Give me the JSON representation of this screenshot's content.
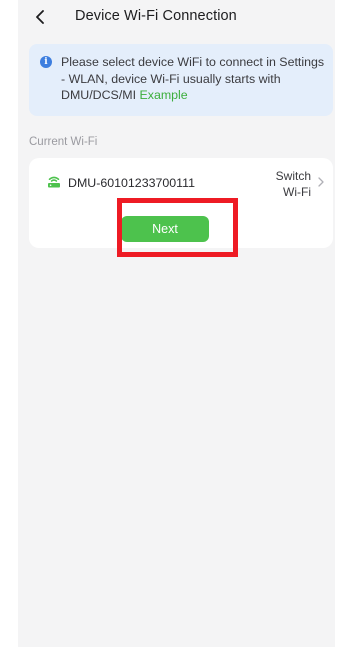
{
  "header": {
    "title": "Device Wi-Fi Connection",
    "back_icon": "chevron-left-icon"
  },
  "notice": {
    "icon": "info-icon",
    "icon_glyph": "i",
    "text": "Please select device WiFi to connect in Settings - WLAN, device Wi-Fi usually starts with DMU/DCS/MI",
    "link": "Example"
  },
  "current_wifi": {
    "section_label": "Current Wi-Fi",
    "wifi_icon": "router-icon",
    "name": "DMU-60101233700111",
    "switch_label": "Switch Wi-Fi",
    "chevron_icon": "chevron-right-icon"
  },
  "actions": {
    "next_label": "Next"
  },
  "colors": {
    "accent_green": "#4dc24d",
    "link_green": "#3cae3c",
    "info_blue": "#3d7edf",
    "notice_background": "#e4eefb",
    "highlight_red": "#ee1b24"
  }
}
